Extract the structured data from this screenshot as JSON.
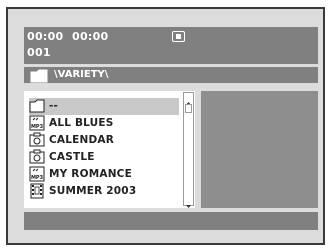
{
  "status": {
    "time_elapsed": "00:00",
    "time_total": "00:00",
    "track_number": "001",
    "playback_state_icon": "stop-icon"
  },
  "path": {
    "icon": "folder-icon",
    "text": "\\VARIETY\\"
  },
  "file_list": {
    "items": [
      {
        "label": "--",
        "icon": "folder-icon",
        "selected": true
      },
      {
        "label": "ALL BLUES",
        "icon": "mp3-icon",
        "selected": false
      },
      {
        "label": "CALENDAR",
        "icon": "photo-icon",
        "selected": false
      },
      {
        "label": "CASTLE",
        "icon": "photo-icon",
        "selected": false
      },
      {
        "label": "MY ROMANCE",
        "icon": "mp3-icon",
        "selected": false
      },
      {
        "label": "SUMMER 2003",
        "icon": "video-icon",
        "selected": false
      }
    ],
    "mp3_icon_text": "MP3"
  },
  "colors": {
    "bar": "#808080",
    "background": "#dcdcdc",
    "selected_row": "#c8c8c8",
    "text_on_bar": "#ffffff"
  }
}
